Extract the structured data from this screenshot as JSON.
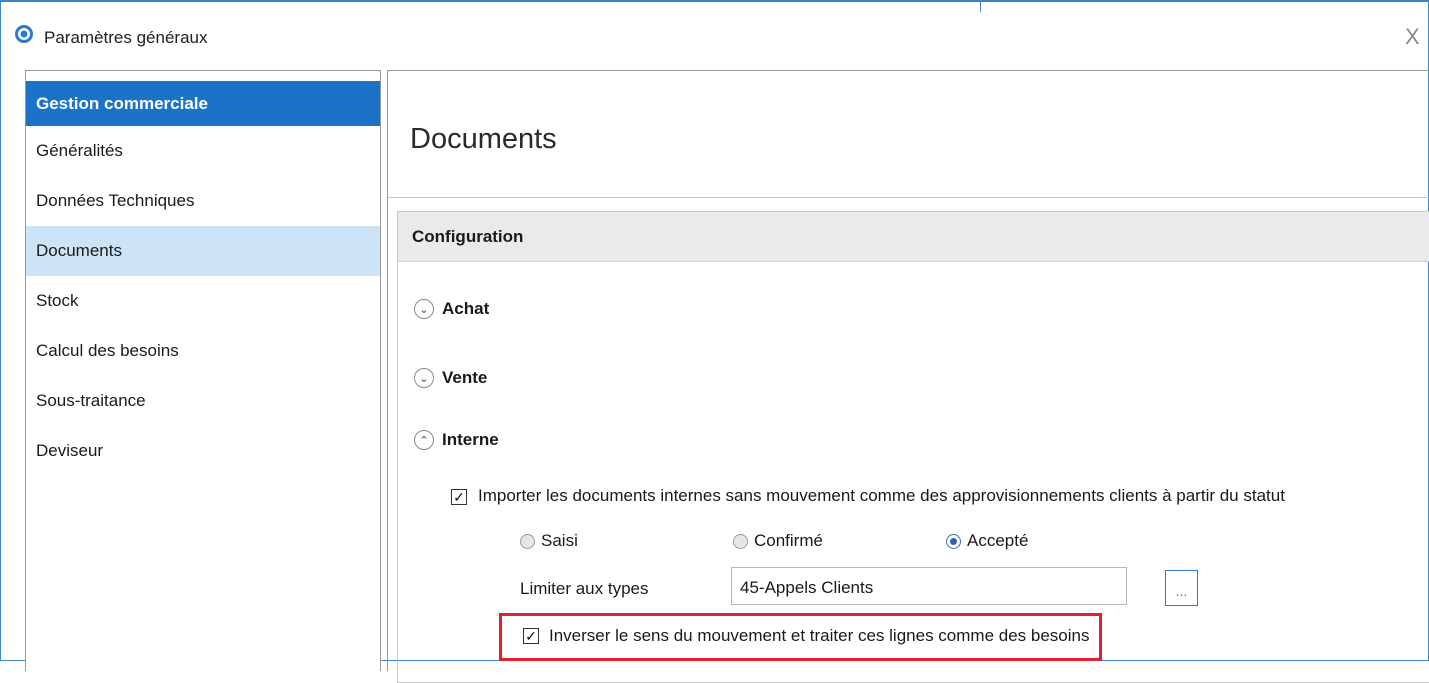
{
  "window": {
    "title": "Paramètres généraux",
    "close_glyph": "X"
  },
  "sidebar": {
    "header": "Gestion commerciale",
    "items": [
      {
        "label": "Généralités"
      },
      {
        "label": "Données Techniques"
      },
      {
        "label": "Documents"
      },
      {
        "label": "Stock"
      },
      {
        "label": "Calcul des besoins"
      },
      {
        "label": "Sous-traitance"
      },
      {
        "label": "Deviseur"
      }
    ],
    "selected": "Documents"
  },
  "main": {
    "title": "Documents",
    "section_title": "Configuration",
    "groups": [
      {
        "label": "Achat",
        "expanded": false
      },
      {
        "label": "Vente",
        "expanded": false
      },
      {
        "label": "Interne",
        "expanded": true
      }
    ],
    "import_checkbox": {
      "label": "Importer les documents internes sans mouvement comme des approvisionnements clients à partir du statut",
      "checked": true
    },
    "status_radios": [
      {
        "label": "Saisi",
        "selected": false
      },
      {
        "label": "Confirmé",
        "selected": false
      },
      {
        "label": "Accepté",
        "selected": true
      }
    ],
    "limit_types": {
      "label": "Limiter aux types",
      "value": "45-Appels Clients",
      "browse_label": "..."
    },
    "invert_checkbox": {
      "label": "Inverser le sens du mouvement et traiter ces lignes comme des besoins",
      "checked": true
    }
  },
  "colors": {
    "accent": "#1a73c9",
    "selection": "#cde3f6",
    "highlight": "#e0202c"
  }
}
